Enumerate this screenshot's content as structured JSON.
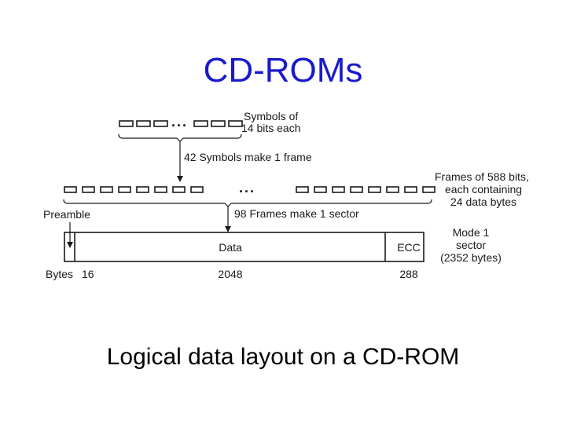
{
  "title": "CD-ROMs",
  "caption": "Logical data layout on a CD-ROM",
  "colors": {
    "title": "#1a1acc",
    "text": "#000000",
    "lines": "#1a1a1a"
  },
  "diagram": {
    "symbols": {
      "label_line1": "Symbols of",
      "label_line2": "14 bits each",
      "ellipsis": "...",
      "group_label": "42 Symbols make 1 frame"
    },
    "frames": {
      "label_line1": "Frames of 588 bits,",
      "label_line2": "each containing",
      "label_line3": "24 data bytes",
      "ellipsis": "...",
      "group_label": "98 Frames make 1 sector"
    },
    "sector": {
      "preamble_label": "Preamble",
      "fields": [
        {
          "name": "Preamble",
          "bytes": "16"
        },
        {
          "name": "Data",
          "bytes": "2048"
        },
        {
          "name": "ECC",
          "bytes": "288"
        }
      ],
      "bytes_prefix": "Bytes",
      "mode_label_line1": "Mode 1",
      "mode_label_line2": "sector",
      "mode_label_line3": "(2352 bytes)"
    }
  }
}
